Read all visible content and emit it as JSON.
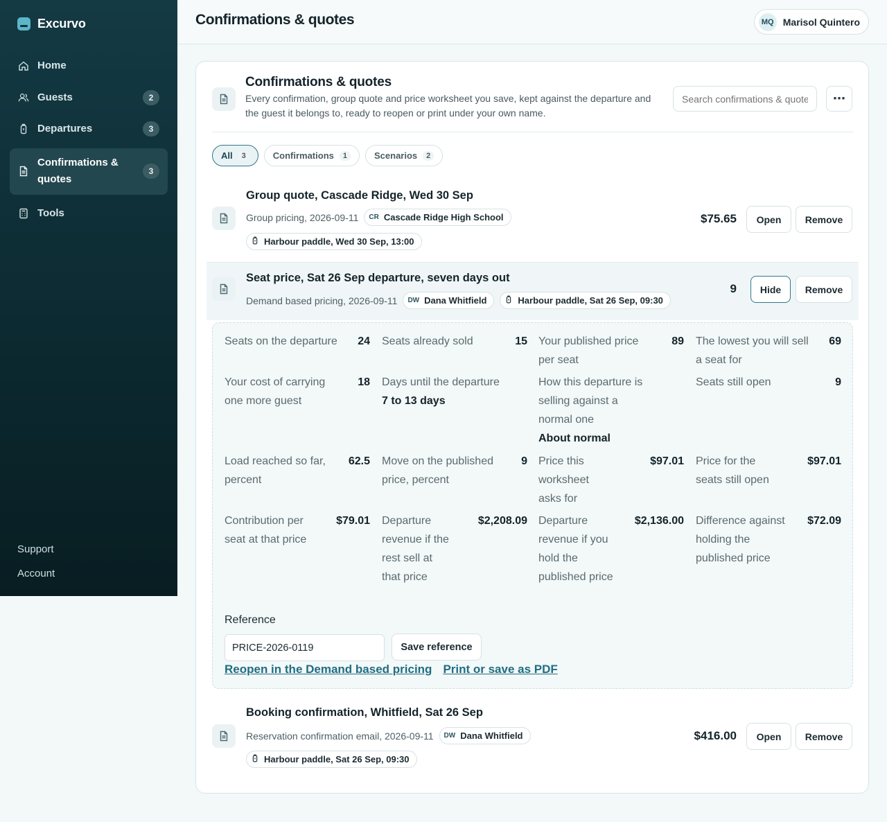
{
  "app": {
    "name": "Excurvo"
  },
  "sidebar": {
    "items": [
      {
        "label": "Home",
        "icon": "home-icon",
        "badge": ""
      },
      {
        "label": "Guests",
        "icon": "users-icon",
        "badge": "2"
      },
      {
        "label": "Departures",
        "icon": "paddle-icon",
        "badge": "3"
      },
      {
        "label": "Confirmations & quotes",
        "icon": "document-icon",
        "badge": "3",
        "active": true
      },
      {
        "label": "Tools",
        "icon": "calculator-icon",
        "badge": ""
      }
    ],
    "footer": {
      "support": "Support",
      "account": "Account"
    }
  },
  "header": {
    "title": "Confirmations & quotes",
    "user": {
      "initials": "MQ",
      "name": "Marisol Quintero"
    }
  },
  "card": {
    "title": "Confirmations & quotes",
    "description": "Every confirmation, group quote and price worksheet you save, kept against the departure and the guest it belongs to, ready to reopen or print under your own name.",
    "search_placeholder": "Search confirmations & quotes",
    "more_label": "⋯",
    "filters": [
      {
        "label": "All",
        "count": "3",
        "active": true
      },
      {
        "label": "Confirmations",
        "count": "1"
      },
      {
        "label": "Scenarios",
        "count": "2"
      }
    ]
  },
  "rows": [
    {
      "title": "Group quote, Cascade Ridge, Wed 30 Sep",
      "meta": "Group pricing, 2026-09-11",
      "tag_initials": "CR",
      "tag_name": "Cascade Ridge High School",
      "departure": "Harbour paddle, Wed 30 Sep, 13:00",
      "value": "$75.65",
      "action": "Open",
      "remove": "Remove"
    },
    {
      "title": "Seat price, Sat 26 Sep departure, seven days out",
      "meta": "Demand based pricing, 2026-09-11",
      "tag_initials": "DW",
      "tag_name": "Dana Whitfield",
      "departure": "Harbour paddle, Sat 26 Sep, 09:30",
      "value": "9",
      "action": "Hide",
      "remove": "Remove"
    },
    {
      "title": "Booking confirmation, Whitfield, Sat 26 Sep",
      "meta": "Reservation confirmation email, 2026-09-11",
      "tag_initials": "DW",
      "tag_name": "Dana Whitfield",
      "departure": "Harbour paddle, Sat 26 Sep, 09:30",
      "value": "$416.00",
      "action": "Open",
      "remove": "Remove"
    }
  ],
  "details": {
    "fields": [
      {
        "label": "Seats on the departure",
        "value": "24"
      },
      {
        "label": "Seats already sold",
        "value": "15"
      },
      {
        "label": "Your published price per seat",
        "value": "89"
      },
      {
        "label": "The lowest you will sell a seat for",
        "value": "69"
      },
      {
        "label": "Your cost of carrying one more guest",
        "value": "18"
      },
      {
        "label": "Days until the departure",
        "value": "",
        "sub": "7 to 13 days"
      },
      {
        "label": "How this departure is selling against a normal one",
        "value": "",
        "sub": "About normal"
      },
      {
        "label": "Seats still open",
        "value": "9"
      },
      {
        "label": "Load reached so far, percent",
        "value": "62.5"
      },
      {
        "label": "Move on the published price, percent",
        "value": "9"
      },
      {
        "label": "Price this worksheet asks for",
        "value": "$97.01"
      },
      {
        "label": "Price for the seats still open",
        "value": "$97.01"
      },
      {
        "label": "Contribution per seat at that price",
        "value": "$79.01"
      },
      {
        "label": "Departure revenue if the rest sell at that price",
        "value": "$2,208.09"
      },
      {
        "label": "Departure revenue if you hold the published price",
        "value": "$2,136.00"
      },
      {
        "label": "Difference against holding the published price",
        "value": "$72.09"
      }
    ],
    "reference_label": "Reference",
    "reference_value": "PRICE-2026-0119",
    "save_reference": "Save reference",
    "reopen_link": "Reopen in the Demand based pricing",
    "print_link": "Print or save as PDF"
  }
}
